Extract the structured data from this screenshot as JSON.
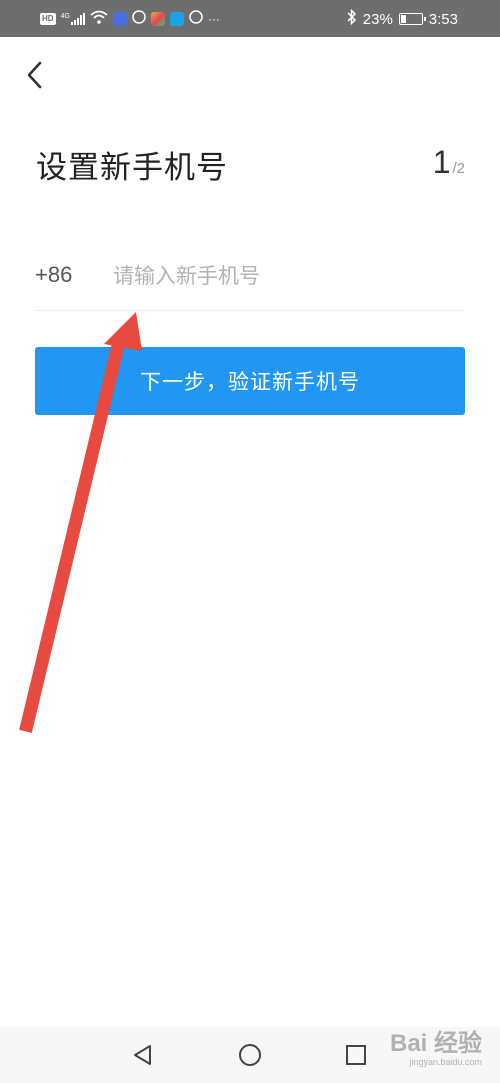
{
  "status_bar": {
    "hd_label": "HD",
    "network_label": "4G",
    "more_label": "···",
    "battery_text": "23%",
    "battery_level": 0.23,
    "time": "3:53"
  },
  "header": {
    "title": "设置新手机号",
    "step_current": "1",
    "step_total": "/2"
  },
  "phone": {
    "country_code": "+86",
    "placeholder": "请输入新手机号",
    "value": ""
  },
  "next_button": {
    "label": "下一步，验证新手机号"
  },
  "annotation": {
    "color": "#e84a3f"
  },
  "watermark": {
    "text": "Bai 经验",
    "sub": "jingyan.baidu.com"
  },
  "colors": {
    "primary": "#2196f3",
    "status_bar": "#6e6e6e"
  }
}
